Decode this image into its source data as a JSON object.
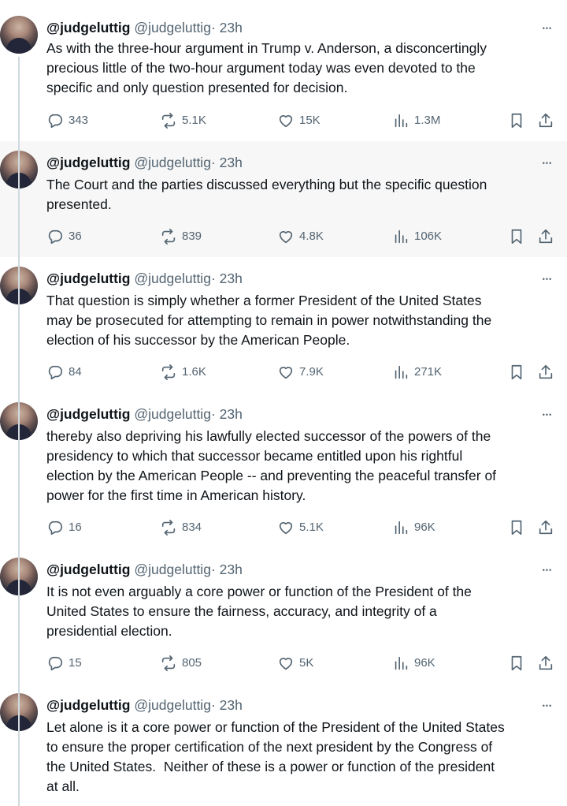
{
  "tweets": [
    {
      "username": "@judgeluttig",
      "handle": "@judgeluttig",
      "time": "· 23h",
      "text": "As with the three-hour argument in Trump v. Anderson, a disconcertingly\nprecious little of the two-hour argument today was even devoted to the\nspecific and only question presented for decision.",
      "replies": "343",
      "reposts": "5.1K",
      "likes": "15K",
      "views": "1.3M",
      "highlighted": false
    },
    {
      "username": "@judgeluttig",
      "handle": "@judgeluttig",
      "time": "· 23h",
      "text": "The Court and the parties discussed everything but the specific question\npresented.",
      "replies": "36",
      "reposts": "839",
      "likes": "4.8K",
      "views": "106K",
      "highlighted": true
    },
    {
      "username": "@judgeluttig",
      "handle": "@judgeluttig",
      "time": "· 23h",
      "text": "That question is simply whether a former President of the United States\nmay be prosecuted for attempting to remain in power notwithstanding the\nelection of his successor by the American People.",
      "replies": "84",
      "reposts": "1.6K",
      "likes": "7.9K",
      "views": "271K",
      "highlighted": false
    },
    {
      "username": "@judgeluttig",
      "handle": "@judgeluttig",
      "time": "· 23h",
      "text": "thereby also depriving his lawfully elected successor of the powers of the\npresidency to which that successor became entitled upon his rightful\nelection by the American People -- and preventing the peaceful transfer of\npower for the first time in American history.",
      "replies": "16",
      "reposts": "834",
      "likes": "5.1K",
      "views": "96K",
      "highlighted": false
    },
    {
      "username": "@judgeluttig",
      "handle": "@judgeluttig",
      "time": "· 23h",
      "text": "It is not even arguably a core power or function of the President of the\nUnited States to ensure the fairness, accuracy, and integrity of a\npresidential election.",
      "replies": "15",
      "reposts": "805",
      "likes": "5K",
      "views": "96K",
      "highlighted": false
    },
    {
      "username": "@judgeluttig",
      "handle": "@judgeluttig",
      "time": "· 23h",
      "text": "Let alone is it a core power or function of the President of the United States\nto ensure the proper certification of the next president by the Congress of\nthe United States.  Neither of these is a power or function of the president\nat all.",
      "replies": null,
      "reposts": null,
      "likes": null,
      "views": null,
      "highlighted": false
    }
  ],
  "icons": {
    "reply": "reply-icon",
    "repost": "repost-icon",
    "like": "like-icon",
    "views": "views-icon",
    "bookmark": "bookmark-icon",
    "share": "share-icon",
    "more": "more-icon"
  },
  "colors": {
    "text": "#0f1419",
    "muted": "#536471",
    "thread_line": "#cfd9de",
    "highlight_bg": "#f7f7f7"
  }
}
